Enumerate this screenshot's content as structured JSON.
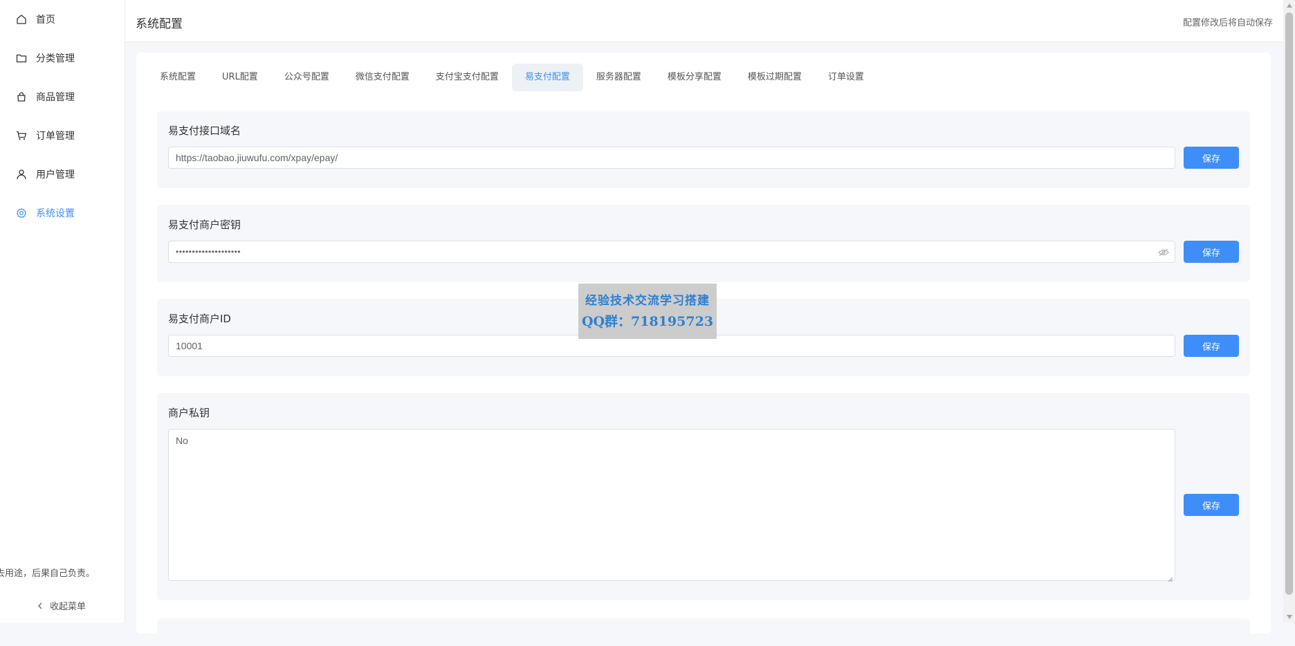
{
  "sidebar": {
    "items": [
      {
        "label": "首页",
        "icon": "home-icon"
      },
      {
        "label": "分类管理",
        "icon": "folder-icon"
      },
      {
        "label": "商品管理",
        "icon": "shopping-bag-icon"
      },
      {
        "label": "订单管理",
        "icon": "cart-icon"
      },
      {
        "label": "用户管理",
        "icon": "user-icon"
      },
      {
        "label": "系统设置",
        "icon": "gear-icon",
        "active": true
      }
    ],
    "disclaimer": "去用途，后果自己负责。",
    "collapse_label": "收起菜单"
  },
  "header": {
    "title": "系统配置",
    "note": "配置修改后将自动保存"
  },
  "tabs": [
    {
      "label": "系统配置"
    },
    {
      "label": "URL配置"
    },
    {
      "label": "公众号配置"
    },
    {
      "label": "微信支付配置"
    },
    {
      "label": "支付宝支付配置"
    },
    {
      "label": "易支付配置",
      "active": true
    },
    {
      "label": "服务器配置"
    },
    {
      "label": "模板分享配置"
    },
    {
      "label": "模板过期配置"
    },
    {
      "label": "订单设置"
    }
  ],
  "fields": {
    "api_domain": {
      "label": "易支付接口域名",
      "value": "https://taobao.jiuwufu.com/xpay/epay/"
    },
    "merchant_key": {
      "label": "易支付商户密钥",
      "value": "••••••••••••••••••••"
    },
    "merchant_id": {
      "label": "易支付商户ID",
      "value": "10001"
    },
    "private_key": {
      "label": "商户私钥",
      "value": "No"
    }
  },
  "save_label": "保存",
  "watermark": {
    "line1": "经验技术交流学习搭建",
    "line2": "QQ群：718195723"
  },
  "colors": {
    "accent": "#3e8ef7",
    "background": "#f5f7fa",
    "block_background": "#f5f7fa"
  }
}
